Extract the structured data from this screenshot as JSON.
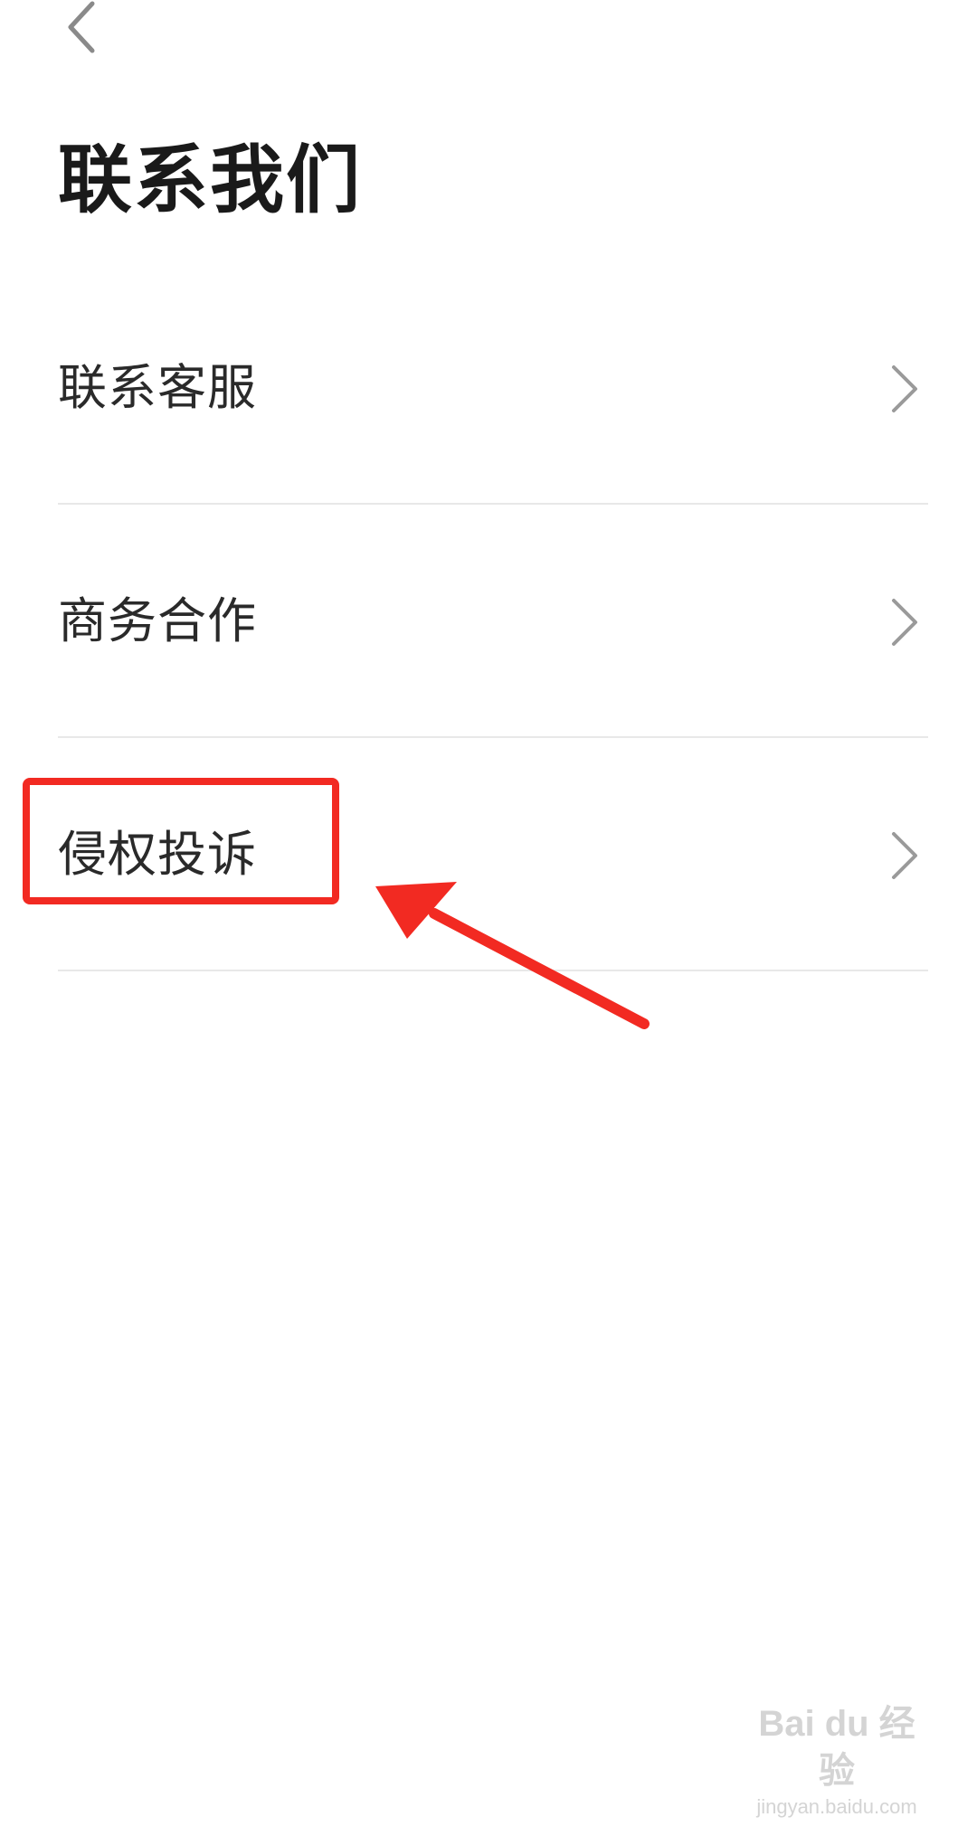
{
  "header": {
    "back_icon": "chevron-left-icon",
    "title": "联系我们"
  },
  "menu": {
    "items": [
      {
        "label": "联系客服",
        "icon": "chevron-right-icon"
      },
      {
        "label": "商务合作",
        "icon": "chevron-right-icon"
      },
      {
        "label": "侵权投诉",
        "icon": "chevron-right-icon"
      }
    ]
  },
  "annotation": {
    "highlight_color": "#f22a22",
    "highlighted_item": "侵权投诉"
  },
  "watermark": {
    "main": "Bai du 经验",
    "sub": "jingyan.baidu.com"
  }
}
